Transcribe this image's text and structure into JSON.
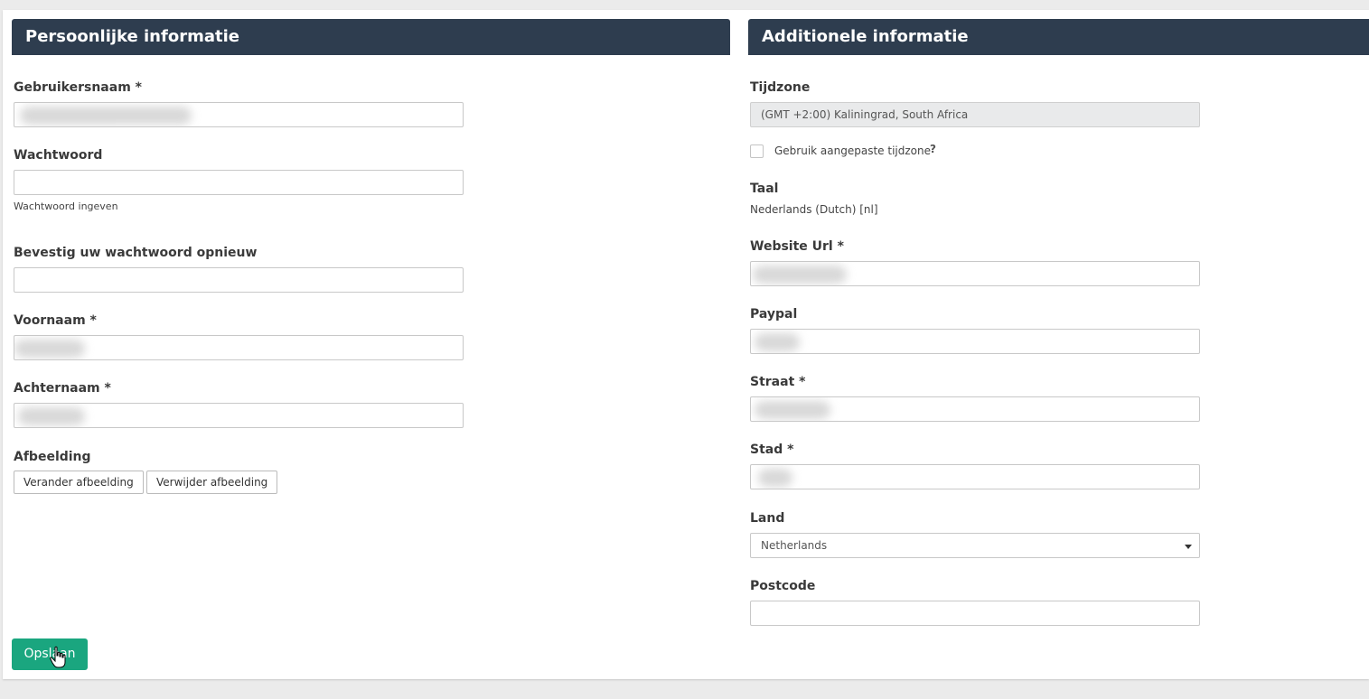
{
  "personal": {
    "title": "Persoonlijke informatie",
    "username_label": "Gebruikersnaam *",
    "username_value": "",
    "password_label": "Wachtwoord",
    "password_value": "",
    "password_help": "Wachtwoord ingeven",
    "confirm_label": "Bevestig uw wachtwoord opnieuw",
    "confirm_value": "",
    "firstname_label": "Voornaam *",
    "firstname_value": "",
    "lastname_label": "Achternaam *",
    "lastname_value": "",
    "image_label": "Afbeelding",
    "change_image_button": "Verander afbeelding",
    "remove_image_button": "Verwijder afbeelding"
  },
  "additional": {
    "title": "Additionele informatie",
    "timezone_label": "Tijdzone",
    "timezone_value": "(GMT +2:00) Kaliningrad, South Africa",
    "custom_timezone_label": "Gebruik aangepaste tijdzone",
    "custom_timezone_checked": false,
    "help_icon": "?",
    "language_label": "Taal",
    "language_value": "Nederlands (Dutch) [nl]",
    "website_label": "Website Url *",
    "website_value": "",
    "paypal_label": "Paypal",
    "paypal_value": "",
    "street_label": "Straat *",
    "street_value": "",
    "city_label": "Stad *",
    "city_value": "",
    "country_label": "Land",
    "country_value": "Netherlands",
    "postcode_label": "Postcode",
    "postcode_value": ""
  },
  "actions": {
    "save_button": "Opslaan"
  },
  "colors": {
    "header_bg": "#2e3d4f",
    "save_button_bg": "#1aa67f",
    "page_bg": "#ebebeb"
  }
}
